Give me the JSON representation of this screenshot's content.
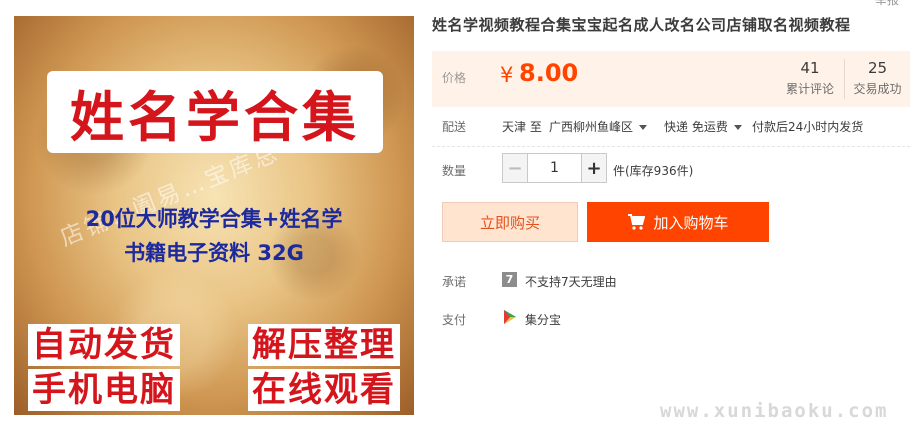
{
  "top_right_text": "举报",
  "image": {
    "title": "姓名学合集",
    "sub1": "20位大师教学合集+姓名学",
    "sub2": "书籍电子资料 32G",
    "watermark": "店铺：阖易…宝库总",
    "row1_left": "自动发货",
    "row1_right": "解压整理",
    "row2_left": "手机电脑",
    "row2_right": "在线观看"
  },
  "product": {
    "title": "姓名学视频教程合集宝宝起名成人改名公司店铺取名视频教程"
  },
  "price": {
    "label": "价格",
    "symbol": "¥",
    "value": "8.00",
    "color": "#ff4400"
  },
  "stats": {
    "reviews_count": "41",
    "reviews_label": "累计评论",
    "sales_count": "25",
    "sales_label": "交易成功"
  },
  "shipping": {
    "label": "配送",
    "from": "天津 至",
    "to": "广西柳州鱼峰区",
    "method": "快递 免运费",
    "dispatch": "付款后24小时内发货"
  },
  "quantity": {
    "label": "数量",
    "minus": "−",
    "value": "1",
    "plus": "+",
    "stock": "件(库存936件)"
  },
  "actions": {
    "buy_now": "立即购买",
    "add_to_cart": "加入购物车",
    "accent": "#ff4400"
  },
  "promise": {
    "label": "承诺",
    "icon_text": "7",
    "text": "不支持7天无理由"
  },
  "payment": {
    "label": "支付",
    "icon": "jifenbao-icon",
    "text": "集分宝"
  },
  "site_watermark": "www.xunibaoku.com"
}
